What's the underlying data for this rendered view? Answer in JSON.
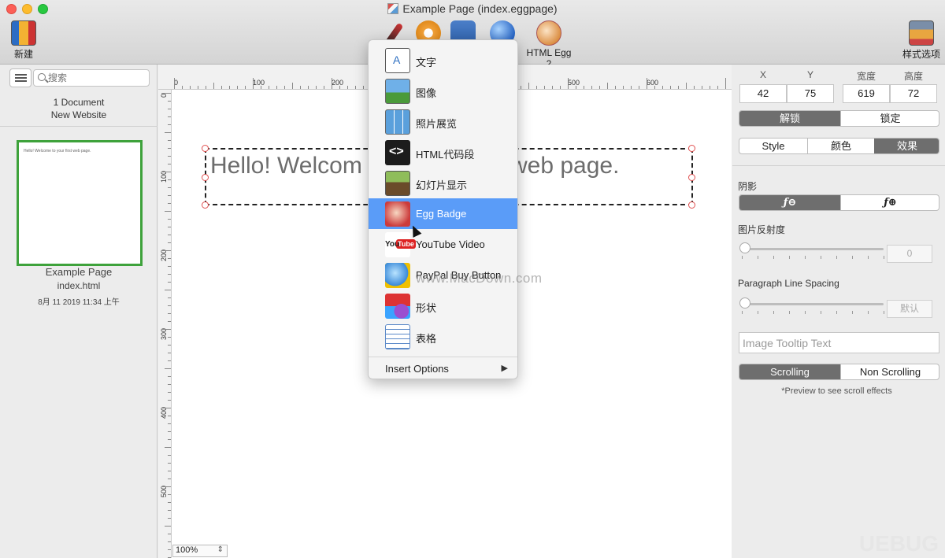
{
  "window": {
    "title": "Example Page (index.eggpage)"
  },
  "toolbar": {
    "new_label": "新建",
    "html_egg_label": "HTML Egg 2",
    "style_options_label": "样式选项"
  },
  "sidebar": {
    "search_placeholder": "搜索",
    "doc_count": "1 Document",
    "site_name": "New Website",
    "page": {
      "thumb_text": "Hello!  Welcome to your first web page.",
      "name": "Example Page",
      "file": "index.html",
      "date": "8月 11 2019 11:34 上午"
    }
  },
  "canvas": {
    "ruler_top_labels": [
      "0",
      "100",
      "200",
      "500",
      "600"
    ],
    "ruler_left_labels": [
      "0",
      "100",
      "200",
      "300",
      "400",
      "500"
    ],
    "text_left": "Hello!  Welcom",
    "text_right": "web page.",
    "zoom": "100%"
  },
  "insert_menu": {
    "items": [
      {
        "label": "文字",
        "icon": "text-icon"
      },
      {
        "label": "图像",
        "icon": "image-icon"
      },
      {
        "label": "照片展览",
        "icon": "gallery-icon"
      },
      {
        "label": "HTML代码段",
        "icon": "code-icon"
      },
      {
        "label": "幻灯片显示",
        "icon": "slideshow-icon"
      },
      {
        "label": "Egg Badge",
        "icon": "egg-badge-icon"
      },
      {
        "label": "YouTube Video",
        "icon": "youtube-icon"
      },
      {
        "label": "PayPal Buy Button",
        "icon": "paypal-icon"
      },
      {
        "label": "形状",
        "icon": "shape-icon"
      },
      {
        "label": "表格",
        "icon": "table-icon"
      }
    ],
    "active_index": 5,
    "options_label": "Insert Options"
  },
  "watermark": "www.MacDown.com",
  "corner_watermark": "UEBUG",
  "inspector": {
    "pos_labels": {
      "x": "X",
      "y": "Y",
      "w": "宽度",
      "h": "高度"
    },
    "pos_values": {
      "x": "42",
      "y": "75",
      "w": "619",
      "h": "72"
    },
    "lock": {
      "unlock": "解锁",
      "lock": "锁定"
    },
    "tabs": {
      "style": "Style",
      "color": "颜色",
      "effect": "效果"
    },
    "shadow_label": "阴影",
    "shadow_off": "fx-off-icon",
    "shadow_on": "fx-on-icon",
    "reflectivity_label": "图片反射度",
    "reflectivity_value": "0",
    "line_spacing_label": "Paragraph Line Spacing",
    "line_spacing_value": "默认",
    "tooltip_placeholder": "Image Tooltip Text",
    "scroll": {
      "on": "Scrolling",
      "off": "Non Scrolling"
    },
    "preview_note": "*Preview to see scroll effects"
  }
}
